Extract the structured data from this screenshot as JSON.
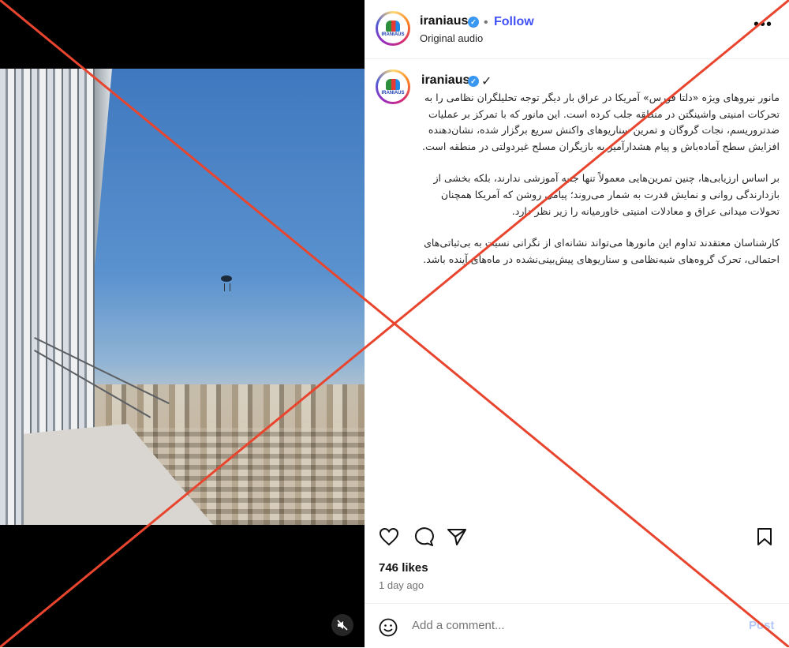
{
  "post": {
    "username": "iraniaus",
    "follow_label": "Follow",
    "separator": "•",
    "audio_label": "Original audio",
    "more_icon": "more-options-icon",
    "avatar_text": "IRANIAUS",
    "caption_username": "iraniaus",
    "caption_check": "✓",
    "caption_paragraphs": [
      "مانور نیروهای ویژه «دلتا فورس» آمریکا در عراق بار دیگر توجه تحلیلگران نظامی را به تحرکات امنیتی واشینگتن در منطقه جلب کرده است. این مانور که با تمرکز بر عملیات ضدتروریسم، نجات گروگان و تمرین سناریوهای واکنش سریع برگزار شده، نشان‌دهنده افزایش سطح آمادەباش و پیام هشدارآمیز به بازیگران مسلح غیردولتی در منطقه است.",
      "بر اساس ارزیابی‌ها، چنین تمرین‌هایی معمولاً تنها جنبه آموزشی ندارند، بلکه بخشی از بازدارندگی روانی و نمایش قدرت به شمار می‌روند؛ پیامی روشن که آمریکا همچنان تحولات میدانی عراق و معادلات امنیتی خاورمیانه را زیر نظر دارد.",
      "کارشناسان معتقدند تداوم این مانورها می‌تواند نشانه‌ای از نگرانی نسبت به بی‌ثباتی‌های احتمالی، تحرک گروه‌های شبه‌نظامی و سناریوهای پیش‌بینی‌نشده در ماه‌های آینده باشد."
    ],
    "likes": "746 likes",
    "time_ago": "1 day ago",
    "comment_placeholder": "Add a comment...",
    "post_label": "Post"
  },
  "colors": {
    "follow": "#4150f7",
    "verified": "#3897f0",
    "cross": "#e8452f"
  },
  "icons": [
    "heart-icon",
    "comment-icon",
    "share-icon",
    "bookmark-icon",
    "emoji-icon",
    "mute-icon",
    "verified-icon"
  ]
}
